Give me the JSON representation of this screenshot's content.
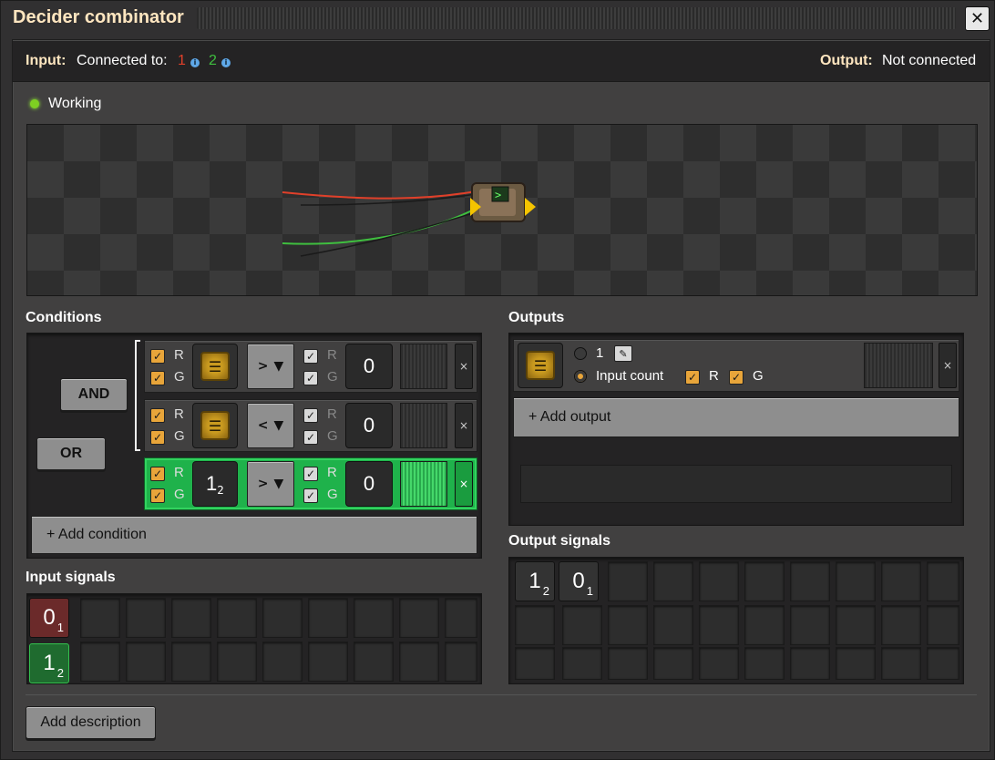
{
  "window": {
    "title": "Decider combinator",
    "close_symbol": "✕"
  },
  "header": {
    "input_label": "Input:",
    "connected_to_label": "Connected to:",
    "red_network": "1",
    "green_network": "2",
    "info_symbol": "i",
    "output_label": "Output:",
    "output_status": "Not connected"
  },
  "status": {
    "text": "Working",
    "color": "#7ed022"
  },
  "conditions": {
    "title": "Conditions",
    "and_label": "AND",
    "or_label": "OR",
    "rows": [
      {
        "r": "R",
        "g": "G",
        "operator": ">",
        "r2": "R",
        "g2": "G",
        "value": "0",
        "signal_icon": "chip-icon"
      },
      {
        "r": "R",
        "g": "G",
        "operator": "<",
        "r2": "R",
        "g2": "G",
        "value": "0",
        "signal_icon": "chip-icon"
      },
      {
        "r": "R",
        "g": "G",
        "operator": ">",
        "r2": "R",
        "g2": "G",
        "value": "0",
        "signal_main": "1",
        "signal_sub": "2"
      }
    ],
    "add_condition": "+ Add condition",
    "remove_symbol": "×"
  },
  "outputs": {
    "title": "Outputs",
    "constant_value": "1",
    "input_count_label": "Input count",
    "r": "R",
    "g": "G",
    "add_output": "+ Add output",
    "remove_symbol": "×"
  },
  "input_signals": {
    "title": "Input signals",
    "items": [
      {
        "main": "0",
        "sub": "1",
        "network": "red"
      },
      {
        "main": "1",
        "sub": "2",
        "network": "green"
      }
    ]
  },
  "output_signals": {
    "title": "Output signals",
    "items": [
      {
        "main": "1",
        "sub": "2"
      },
      {
        "main": "0",
        "sub": "1"
      }
    ]
  },
  "footer": {
    "add_description": "Add description"
  },
  "colors": {
    "accent_text": "#ffe6c0",
    "red_wire": "#e0402a",
    "green_wire": "#3fbf3f",
    "orange_check": "#e8a53a",
    "active_row": "#1fb24b"
  }
}
